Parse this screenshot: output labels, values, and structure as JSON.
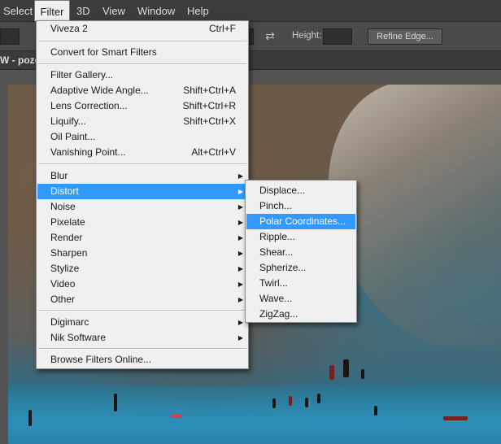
{
  "menubar": {
    "items": [
      "Select",
      "Filter",
      "3D",
      "View",
      "Window",
      "Help"
    ],
    "active": "Filter"
  },
  "options": {
    "height_label": "Height:",
    "refine_label": "Refine Edge..."
  },
  "document": {
    "tab_label": "W - pozo"
  },
  "filter_menu": {
    "items": [
      {
        "label": "Viveza 2",
        "shortcut": "Ctrl+F"
      },
      {
        "label": "Convert for Smart Filters",
        "shortcut": ""
      },
      {
        "label": "Filter Gallery...",
        "shortcut": ""
      },
      {
        "label": "Adaptive Wide Angle...",
        "shortcut": "Shift+Ctrl+A"
      },
      {
        "label": "Lens Correction...",
        "shortcut": "Shift+Ctrl+R"
      },
      {
        "label": "Liquify...",
        "shortcut": "Shift+Ctrl+X"
      },
      {
        "label": "Oil Paint...",
        "shortcut": ""
      },
      {
        "label": "Vanishing Point...",
        "shortcut": "Alt+Ctrl+V"
      },
      {
        "label": "Blur",
        "shortcut": ""
      },
      {
        "label": "Distort",
        "shortcut": ""
      },
      {
        "label": "Noise",
        "shortcut": ""
      },
      {
        "label": "Pixelate",
        "shortcut": ""
      },
      {
        "label": "Render",
        "shortcut": ""
      },
      {
        "label": "Sharpen",
        "shortcut": ""
      },
      {
        "label": "Stylize",
        "shortcut": ""
      },
      {
        "label": "Video",
        "shortcut": ""
      },
      {
        "label": "Other",
        "shortcut": ""
      },
      {
        "label": "Digimarc",
        "shortcut": ""
      },
      {
        "label": "Nik Software",
        "shortcut": ""
      },
      {
        "label": "Browse Filters Online...",
        "shortcut": ""
      }
    ]
  },
  "distort_menu": {
    "items": [
      {
        "label": "Displace..."
      },
      {
        "label": "Pinch..."
      },
      {
        "label": "Polar Coordinates..."
      },
      {
        "label": "Ripple..."
      },
      {
        "label": "Shear..."
      },
      {
        "label": "Spherize..."
      },
      {
        "label": "Twirl..."
      },
      {
        "label": "Wave..."
      },
      {
        "label": "ZigZag..."
      }
    ]
  },
  "colors": {
    "highlight": "#3399ff",
    "menu_bg": "#f0f0f0",
    "app_bg": "#535353"
  }
}
